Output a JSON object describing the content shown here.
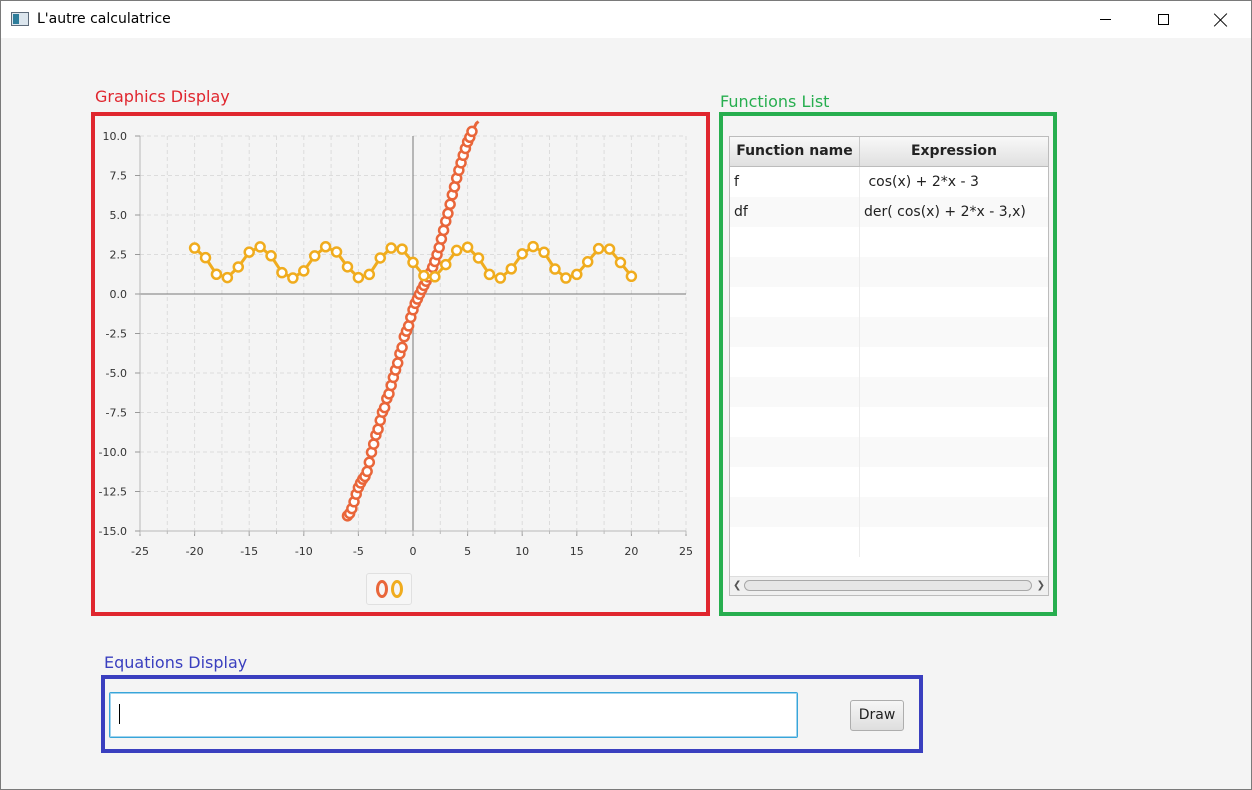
{
  "window": {
    "title": "L'autre calculatrice",
    "minimize_icon": "minimize-icon",
    "maximize_icon": "maximize-icon",
    "close_icon": "close-icon"
  },
  "sections": {
    "graphics_label": "Graphics Display",
    "functions_label": "Functions List",
    "equations_label": "Equations Display",
    "graphics_color": "#e0262e",
    "functions_color": "#27ae4f",
    "equations_color": "#3a3fbf"
  },
  "chart_data": {
    "type": "scatter",
    "xlim": [
      -25,
      25
    ],
    "ylim": [
      -15,
      10
    ],
    "xticks": [
      "-25",
      "-20",
      "-15",
      "-10",
      "-5",
      "0",
      "5",
      "10",
      "15",
      "20",
      "25"
    ],
    "yticks": [
      "10.0",
      "7.5",
      "5.0",
      "2.5",
      "0.0",
      "-2.5",
      "-5.0",
      "-7.5",
      "-10.0",
      "-12.5",
      "-15.0"
    ],
    "grid": true,
    "legend_position": "bottom",
    "series": [
      {
        "color": "#e9663a",
        "x": [
          -6,
          -5.8,
          -5.6,
          -5.4,
          -5.2,
          -5,
          -4.8,
          -4.6,
          -4.4,
          -4.2,
          -4,
          -3.8,
          -3.6,
          -3.4,
          -3.2,
          -3,
          -2.8,
          -2.6,
          -2.4,
          -2.2,
          -2,
          -1.8,
          -1.6,
          -1.4,
          -1.2,
          -1,
          -0.8,
          -0.6,
          -0.4,
          -0.2,
          0,
          0.2,
          0.4,
          0.6,
          0.8,
          1,
          1.2,
          1.4,
          1.6,
          1.8,
          2,
          2.2,
          2.4,
          2.6,
          2.8,
          3,
          3.2,
          3.4,
          3.6,
          3.8,
          4,
          4.2,
          4.4,
          4.6,
          4.8,
          5,
          5.2,
          5.4,
          5.6,
          5.8,
          6
        ],
        "y": [
          -14.04,
          -13.89,
          -13.58,
          -13.15,
          -12.67,
          -12.25,
          -11.96,
          -11.72,
          -11.55,
          -11.23,
          -10.65,
          -10.02,
          -9.5,
          -8.93,
          -8.56,
          -8.0,
          -7.48,
          -7.19,
          -6.62,
          -6.32,
          -5.79,
          -5.28,
          -4.81,
          -4.37,
          -3.78,
          -3.38,
          -2.7,
          -2.35,
          -2.02,
          -1.48,
          -1.0,
          -0.59,
          -0.32,
          -0.01,
          0.28,
          0.54,
          0.81,
          1.08,
          1.36,
          1.69,
          2.06,
          2.49,
          2.94,
          3.48,
          4.03,
          4.6,
          5.1,
          5.68,
          6.28,
          6.78,
          7.33,
          7.83,
          8.3,
          8.78,
          9.21,
          9.63,
          9.92,
          10.29,
          10.54,
          10.8,
          10.92
        ]
      },
      {
        "color": "#f0ac1e",
        "x": [
          -20,
          -19,
          -18,
          -17,
          -16,
          -15,
          -14,
          -13,
          -12,
          -11,
          -10,
          -9,
          -8,
          -7,
          -6,
          -5,
          -4,
          -3,
          -2,
          -1,
          0,
          1,
          2,
          3,
          4,
          5,
          6,
          7,
          8,
          9,
          10,
          11,
          12,
          13,
          14,
          15,
          16,
          17,
          18,
          19,
          20
        ],
        "y": [
          2.91,
          2.3,
          1.25,
          1.04,
          1.71,
          2.65,
          2.98,
          2.42,
          1.35,
          1.01,
          1.46,
          2.41,
          2.99,
          2.66,
          1.72,
          1.04,
          1.24,
          2.28,
          2.91,
          2.84,
          2.0,
          1.16,
          1.09,
          1.86,
          2.76,
          2.96,
          2.28,
          1.24,
          1.01,
          1.59,
          2.54,
          3.0,
          2.64,
          1.58,
          1.01,
          1.24,
          2.04,
          2.87,
          2.84,
          1.99,
          1.12
        ]
      }
    ]
  },
  "table": {
    "headers": [
      "Function name",
      "Expression"
    ],
    "rows": [
      {
        "name": "f",
        "expression": " cos(x) + 2*x - 3"
      },
      {
        "name": "df",
        "expression": "der( cos(x) + 2*x - 3,x)"
      }
    ],
    "scroll_left_icon": "scroll-left-icon",
    "scroll_right_icon": "scroll-right-icon"
  },
  "equations": {
    "input_value": "",
    "draw_label": "Draw"
  }
}
